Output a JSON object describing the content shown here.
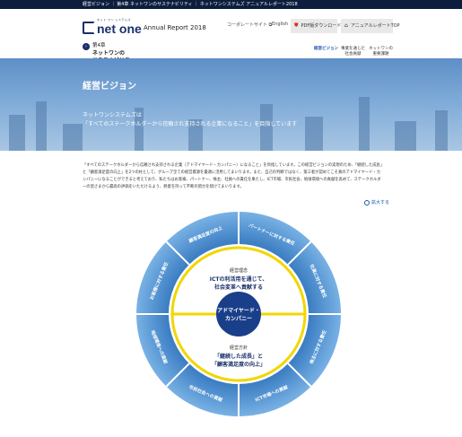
{
  "topbar": {
    "breadcrumb": "経営ビジョン ｜ 第4章 ネットワンのサステナビリティ ｜ ネットワンシステムズ アニュアルレポート2018"
  },
  "header": {
    "logo_tagline": "ネット ワン システムズ",
    "logo_text": "net one",
    "report_title": "Annual Report 2018",
    "corporate_link": "コーポレートサイト ⧉",
    "english_link": "English",
    "pdf_button": "PDF版ダウンロード",
    "top_button": "アニュアルレポートTOP"
  },
  "chapter": {
    "number": "第4章",
    "title_line1": "ネットワンの",
    "title_line2": "サステナビリティ"
  },
  "nav": [
    {
      "line1": "経営ビジョン",
      "line2": ""
    },
    {
      "line1": "事業を通じた",
      "line2": "社会貢献"
    },
    {
      "line1": "ネットワンの",
      "line2": "重要課題"
    }
  ],
  "hero": {
    "title": "経営ビジョン",
    "subtitle_line1": "ネットワンシステムズは",
    "subtitle_line2": "「すべてのステークホルダーから信頼され支持される企業になること」を目指しています"
  },
  "body_text": "「すべてのステークホルダーから信頼され支持される企業（アドマイヤード・カンパニー）になること」を目指しています。この経営ビジョンの実現のため、「継続した成長」と「顧客満足度の向上」を2つの柱として、グループ全ての経営資源を最適に活用してまいります。また、自己の判断ではなく、第三者が認めてこそ真のアドマイヤード・カンパニーになることができると考えており、私たちはお客様、パートナー、株主、社員への責任を果たし、ICT市場、市民社会、地球環境への貢献を高めて、ステークホルダーの皆さまから最高の評価をいただけるよう、熱意を持って不断の努力を続けてまいります。",
  "expand_link": "拡大する",
  "diagram": {
    "center_line1": "アドマイヤード・",
    "center_line2": "カンパニー",
    "philosophy_label": "経営理念",
    "philosophy_line1": "ICTの利活用を通じて、",
    "philosophy_line2": "社会変革へ貢献する",
    "policy_label": "経営方針",
    "policy_line1": "「継続した成長」と",
    "policy_line2": "「顧客満足度の向上」",
    "segments": [
      "パートナーに対する責任",
      "社員に対する責任",
      "株主に対する責任",
      "ICT市場への貢献",
      "市民社会への貢献",
      "地球環境への貢献",
      "お客様に対する責任",
      "顧客満足度の向上"
    ]
  },
  "colors": {
    "navy": "#0d1d3d",
    "accent": "#1a56b0",
    "ring": "#5b9bd5",
    "inner_ring": "#f2d600"
  }
}
